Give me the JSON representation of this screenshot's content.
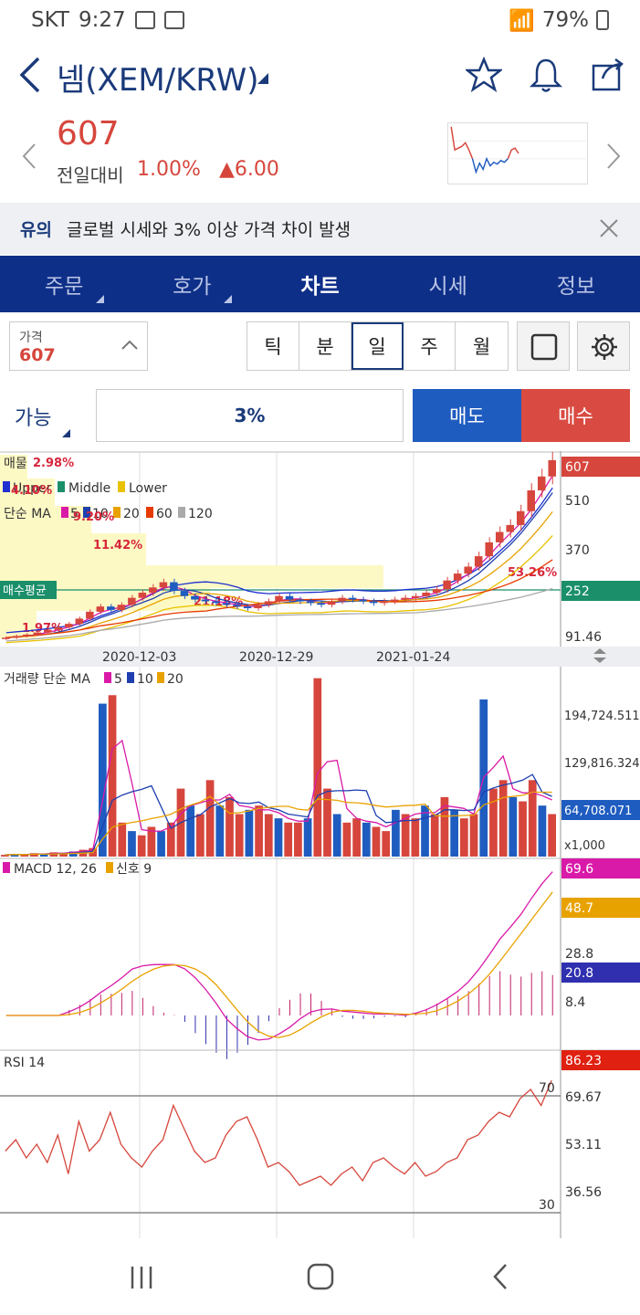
{
  "status": {
    "carrier": "SKT",
    "time": "9:27",
    "battery": "79%"
  },
  "header": {
    "title": "넴(XEM/KRW)"
  },
  "price": {
    "current": "607",
    "prev_label": "전일대비",
    "change_pct": "1.00%",
    "change_val": "▲6.00"
  },
  "notice": {
    "tag": "유의",
    "text": "글로벌 시세와 3% 이상 가격 차이 발생"
  },
  "tabs": [
    "주문",
    "호가",
    "차트",
    "시세",
    "정보"
  ],
  "controls": {
    "price_label": "가격",
    "price_value": "607",
    "periods": [
      "틱",
      "분",
      "일",
      "주",
      "월"
    ],
    "selected_period": "일"
  },
  "order": {
    "avail_label": "가능",
    "pct": "3%",
    "sell": "매도",
    "buy": "매수"
  },
  "chart_data": {
    "type": "candlestick",
    "legend_main": [
      "매물",
      "Upper",
      "Middle",
      "Lower"
    ],
    "ma_label": "단순 MA",
    "ma_periods": [
      "5",
      "10",
      "20",
      "60",
      "120"
    ],
    "price_axis": [
      "607",
      "510",
      "370",
      "252",
      "91.46"
    ],
    "avg_buy_label": "매수평균",
    "avg_buy_value": "252",
    "profile_pcts": [
      "2.98%",
      "4.10%",
      "9.20%",
      "11.42%",
      "21.18%",
      "1.97%",
      "53.26%"
    ],
    "dates": [
      "2020-12-03",
      "2020-12-29",
      "2021-01-24"
    ],
    "close": [
      95,
      100,
      104,
      110,
      118,
      125,
      135,
      150,
      170,
      185,
      175,
      190,
      210,
      225,
      240,
      255,
      230,
      215,
      205,
      200,
      195,
      190,
      185,
      180,
      190,
      200,
      215,
      205,
      200,
      195,
      190,
      200,
      210,
      205,
      200,
      195,
      200,
      205,
      210,
      215,
      225,
      235,
      260,
      280,
      300,
      330,
      370,
      400,
      420,
      460,
      520,
      560,
      607
    ],
    "volume_label": "거래량 단순 MA",
    "volume_ma": [
      "5",
      "10",
      "20"
    ],
    "volume_axis": [
      "194,724.511",
      "129,816.324",
      "64,708.071",
      "x1,000"
    ],
    "volume": [
      2,
      3,
      2,
      4,
      3,
      5,
      4,
      6,
      8,
      10,
      180,
      190,
      40,
      30,
      25,
      35,
      30,
      40,
      80,
      60,
      50,
      90,
      60,
      70,
      50,
      55,
      60,
      50,
      45,
      40,
      40,
      45,
      210,
      80,
      50,
      40,
      45,
      40,
      35,
      30,
      55,
      50,
      45,
      60,
      50,
      70,
      55,
      45,
      50,
      185,
      80,
      90,
      70,
      65,
      90,
      60,
      50
    ],
    "macd_label": "MACD 12, 26",
    "macd_signal_label": "신호 9",
    "macd_axis": [
      "69.6",
      "48.7",
      "28.8",
      "20.8",
      "8.4"
    ],
    "rsi_label": "RSI 14",
    "rsi_axis": [
      "86.23",
      "70",
      "69.67",
      "53.11",
      "36.56",
      "30"
    ]
  },
  "colors": {
    "red": "#d6463c",
    "blue": "#1f5cc0",
    "navy": "#0e2f88",
    "green": "#1a8f6a",
    "orange": "#e8a200",
    "magenta": "#d91aa8"
  }
}
